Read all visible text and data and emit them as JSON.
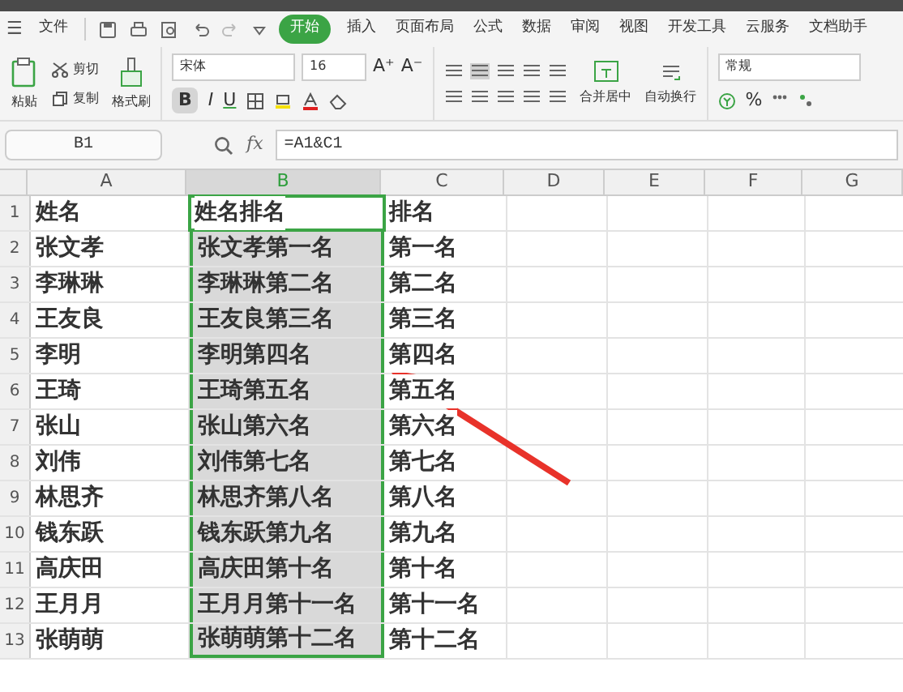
{
  "menu_tabs": [
    {
      "label": "文件",
      "selected": false
    },
    {
      "label": "开始",
      "selected": true
    },
    {
      "label": "插入",
      "selected": false
    },
    {
      "label": "页面布局",
      "selected": false
    },
    {
      "label": "公式",
      "selected": false
    },
    {
      "label": "数据",
      "selected": false
    },
    {
      "label": "审阅",
      "selected": false
    },
    {
      "label": "视图",
      "selected": false
    },
    {
      "label": "开发工具",
      "selected": false
    },
    {
      "label": "云服务",
      "selected": false
    },
    {
      "label": "文档助手",
      "selected": false
    }
  ],
  "menu_glyph": "☰",
  "ribbon": {
    "grow_font": "A⁺",
    "shrink_font": "A⁻",
    "bold_label": "B",
    "italic_label": "I",
    "underline_label": "U",
    "percent": "%",
    "paste": "粘贴",
    "cut": "剪切",
    "copy": "复制",
    "format_painter": "格式刷",
    "font_name": "宋体",
    "font_size": "16",
    "bold": true,
    "align_center": true,
    "merge": "合并居中",
    "wrap": "自动换行",
    "number_format": "常规"
  },
  "formula_bar": {
    "name_box": "B1",
    "fx": "fx",
    "formula": "=A1&C1"
  },
  "columns": [
    {
      "label": "A",
      "selected": false
    },
    {
      "label": "B",
      "selected": true
    },
    {
      "label": "C",
      "selected": false
    },
    {
      "label": "D",
      "selected": false
    },
    {
      "label": "E",
      "selected": false
    },
    {
      "label": "F",
      "selected": false
    },
    {
      "label": "G",
      "selected": false
    }
  ],
  "rows": [
    {
      "header": "1",
      "cells": [
        "姓名",
        "姓名排名",
        "排名"
      ]
    },
    {
      "header": "2",
      "cells": [
        "张文孝",
        "张文孝第一名",
        "第一名"
      ]
    },
    {
      "header": "3",
      "cells": [
        "李琳琳",
        "李琳琳第二名",
        "第二名"
      ]
    },
    {
      "header": "4",
      "cells": [
        "王友良",
        "王友良第三名",
        "第三名"
      ]
    },
    {
      "header": "5",
      "cells": [
        "李明",
        "李明第四名",
        "第四名"
      ]
    },
    {
      "header": "6",
      "cells": [
        "王琦",
        "王琦第五名",
        "第五名"
      ]
    },
    {
      "header": "7",
      "cells": [
        "张山",
        "张山第六名",
        "第六名"
      ]
    },
    {
      "header": "8",
      "cells": [
        "刘伟",
        "刘伟第七名",
        "第七名"
      ]
    },
    {
      "header": "9",
      "cells": [
        "林思齐",
        "林思齐第八名",
        "第八名"
      ]
    },
    {
      "header": "10",
      "cells": [
        "钱东跃",
        "钱东跃第九名",
        "第九名"
      ]
    },
    {
      "header": "11",
      "cells": [
        "高庆田",
        "高庆田第十名",
        "第十名"
      ]
    },
    {
      "header": "12",
      "cells": [
        "王月月",
        "王月月第十一名",
        "第十一名"
      ]
    },
    {
      "header": "13",
      "cells": [
        "张萌萌",
        "张萌萌第十二名",
        "第十二名"
      ]
    }
  ]
}
